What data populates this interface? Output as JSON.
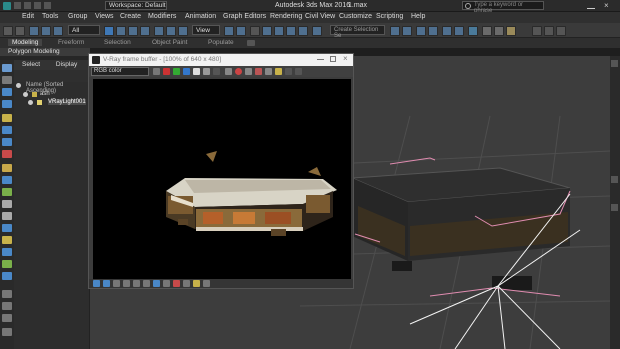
{
  "title_bar": {
    "workspace": "Workspace: Default",
    "app_title": "Autodesk 3ds Max 2016",
    "file": "1.max",
    "search_placeholder": "Type a keyword or phrase"
  },
  "menu": [
    "Edit",
    "Tools",
    "Group",
    "Views",
    "Create",
    "Modifiers",
    "Animation",
    "Graph Editors",
    "Rendering",
    "Civil View",
    "Customize",
    "Scripting",
    "Help"
  ],
  "toolbar": {
    "selection_filter": "All",
    "coord_system": "View",
    "named_selection": "Create Selection Se"
  },
  "ribbon": {
    "tabs": [
      "Modeling",
      "Freeform",
      "Selection",
      "Object Paint",
      "Populate"
    ],
    "active_tab": "Modeling",
    "subpanel": "Polygon Modeling"
  },
  "scene_explorer": {
    "tabs": [
      "Select",
      "Display"
    ],
    "header": "Name (Sorted Ascending)",
    "items": [
      "ash",
      "VRayLight001"
    ]
  },
  "frame_buffer": {
    "title": "V-Ray frame buffer - [100% of 640 x 480]",
    "channel": "RGB color"
  },
  "colors": {
    "accent": "#4f6f8f",
    "viewport_bg": "#3d3d3d",
    "vfb_title_bg": "#f2f2f2"
  }
}
